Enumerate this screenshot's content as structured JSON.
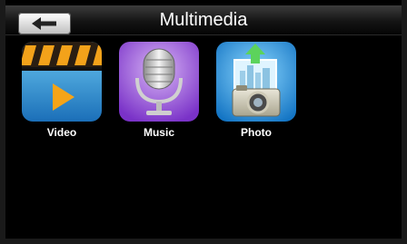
{
  "header": {
    "title": "Multimedia",
    "back_icon": "back-arrow-icon"
  },
  "apps": [
    {
      "label": "Video",
      "icon": "video-clapper-icon"
    },
    {
      "label": "Music",
      "icon": "microphone-icon"
    },
    {
      "label": "Photo",
      "icon": "camera-photo-icon"
    }
  ]
}
